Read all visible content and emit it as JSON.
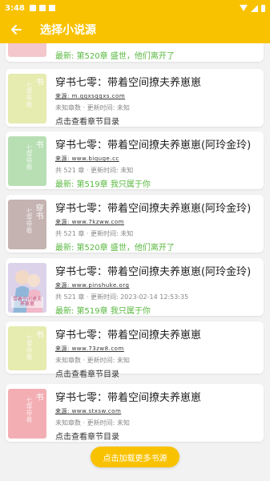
{
  "status": {
    "time": "3:48"
  },
  "header": {
    "title": "选择小说源"
  },
  "partial_card": {
    "latest": "最新: 第520章 盛世，他们离开了",
    "cover_color": "#f3c7cc"
  },
  "cards": [
    {
      "title": "穿书七零：带着空间撩夫养崽崽",
      "source": "来源: m.qqxsqqxs.com",
      "meta": "未知章数 · 更新时间: 未知",
      "line4": "点击查看章节目录",
      "line4_style": "dark",
      "cover_color": "#e6ebb0",
      "cover_text": "书",
      "cover_sub": "七零带着"
    },
    {
      "title": "穿书七零：带着空间撩夫养崽崽(阿玲金玲)",
      "source": "来源: www.biquge.cc",
      "meta": "共 521 章 · 更新时间: 未知",
      "line4": "最新: 第519章 我只属于你",
      "line4_style": "green",
      "cover_color": "#b8dfb4",
      "cover_text": "书",
      "cover_sub": "七零带着"
    },
    {
      "title": "穿书七零：带着空间撩夫养崽崽(阿玲金玲)",
      "source": "来源: www.7kzww.com",
      "meta": "共 521 章 · 更新时间: 未知",
      "line4": "最新: 第520章 盛世，他们离开了",
      "line4_style": "green",
      "cover_color": "#c4b3b0",
      "cover_text": "穿书",
      "cover_sub": "七零带着"
    },
    {
      "title": "穿书七零：带着空间撩夫养崽崽(阿玲金玲)",
      "source": "来源: www.pinshuke.org",
      "meta": "共 521 章 · 更新时间: 2023-02-14 12:53:35",
      "line4": "最新: 第519章 我只属于你",
      "line4_style": "green",
      "cover_color": "#d7cfe6",
      "cover_text": "",
      "cover_sub": "",
      "cover_art": true,
      "cover_art_title": "带着空间撩夫养崽崽"
    },
    {
      "title": "穿书七零：带着空间撩夫养崽崽",
      "source": "来源: www.73zw8.com",
      "meta": "未知章数 · 更新时间: 未知",
      "line4": "点击查看章节目录",
      "line4_style": "dark",
      "cover_color": "#e6ebb0",
      "cover_text": "书",
      "cover_sub": "七零带着"
    },
    {
      "title": "穿书七零：带着空间撩夫养崽崽",
      "source": "来源: www.stxsw.com",
      "meta": "未知章数 · 更新时间: 未知",
      "line4": "点击查看章节目录",
      "line4_style": "dark",
      "cover_color": "#f3aeb3",
      "cover_text": "书",
      "cover_sub": "七零带着"
    }
  ],
  "load_more": "点击加载更多书源"
}
